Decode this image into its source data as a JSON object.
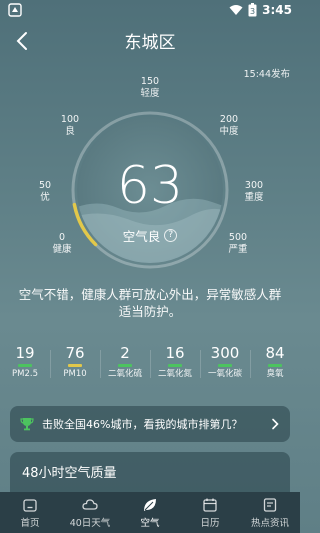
{
  "status": {
    "time": "3:45",
    "battery": "3"
  },
  "header": {
    "city": "东城区"
  },
  "publish_time": "15:44发布",
  "aqi": {
    "value": "63",
    "level": "空气良",
    "help": "?",
    "fraction": 0.126
  },
  "scale": [
    {
      "value": "0",
      "name": "健康"
    },
    {
      "value": "50",
      "name": "优"
    },
    {
      "value": "100",
      "name": "良"
    },
    {
      "value": "150",
      "name": "轻度"
    },
    {
      "value": "200",
      "name": "中度"
    },
    {
      "value": "300",
      "name": "重度"
    },
    {
      "value": "500",
      "name": "严重"
    }
  ],
  "advice": "空气不错，健康人群可放心外出，异常敏感人群适当防护。",
  "pollutants": [
    {
      "value": "19",
      "name": "PM2.5",
      "color": "#4cc35f"
    },
    {
      "value": "76",
      "name": "PM10",
      "color": "#e2c84a"
    },
    {
      "value": "2",
      "name": "二氧化硫",
      "color": "#4cc35f"
    },
    {
      "value": "16",
      "name": "二氧化氮",
      "color": "#4cc35f"
    },
    {
      "value": "300",
      "name": "一氧化碳",
      "color": "#4cc35f"
    },
    {
      "value": "84",
      "name": "臭氧",
      "color": "#4cc35f"
    }
  ],
  "rank": {
    "text": "击败全国46%城市，看我的城市排第几？"
  },
  "section": {
    "title": "48小时空气质量"
  },
  "nav": [
    {
      "label": "首页",
      "icon": "home-icon"
    },
    {
      "label": "40日天气",
      "icon": "cloud-icon"
    },
    {
      "label": "空气",
      "icon": "leaf-icon"
    },
    {
      "label": "日历",
      "icon": "calendar-icon"
    },
    {
      "label": "热点资讯",
      "icon": "news-icon"
    }
  ],
  "colors": {
    "gauge_fill": "#e2c84a",
    "good": "#4cc35f",
    "nav_bg": "#2b3f47"
  }
}
